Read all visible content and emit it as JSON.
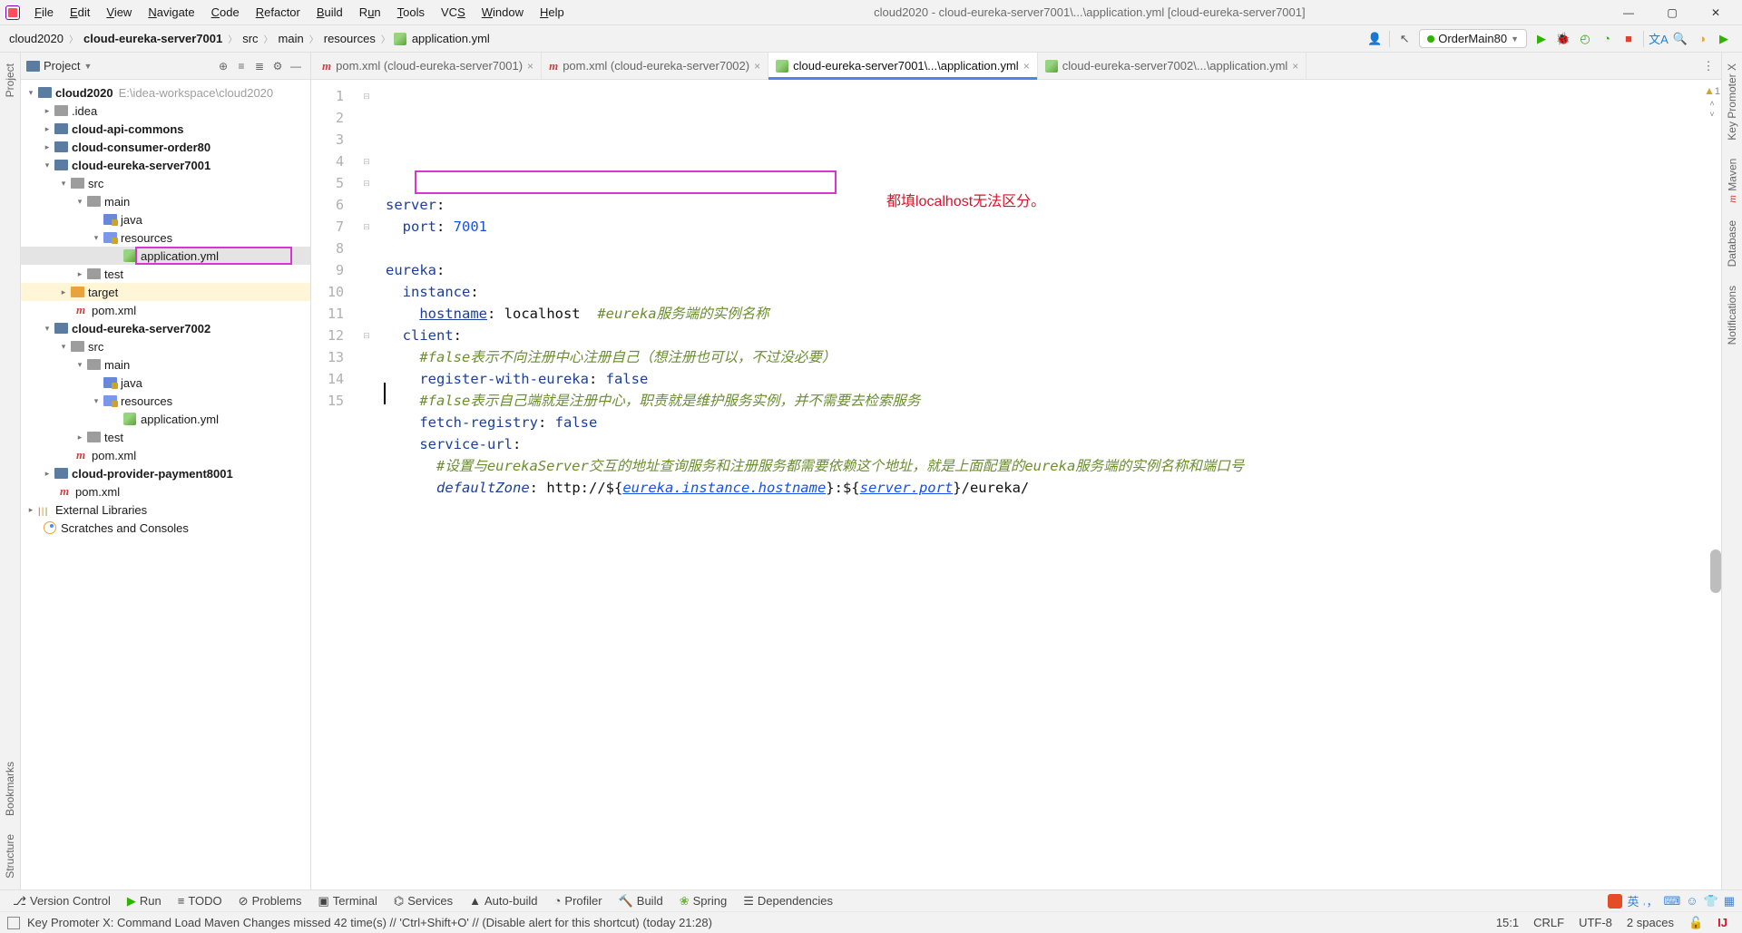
{
  "window": {
    "title": "cloud2020 - cloud-eureka-server7001\\...\\application.yml [cloud-eureka-server7001]"
  },
  "menu": {
    "items": [
      "File",
      "Edit",
      "View",
      "Navigate",
      "Code",
      "Refactor",
      "Build",
      "Run",
      "Tools",
      "VCS",
      "Window",
      "Help"
    ]
  },
  "breadcrumbs": {
    "items": [
      "cloud2020",
      "cloud-eureka-server7001",
      "src",
      "main",
      "resources",
      "application.yml"
    ]
  },
  "run_config": {
    "selected": "OrderMain80"
  },
  "project_panel": {
    "title": "Project",
    "tree": {
      "root": {
        "name": "cloud2020",
        "path": "E:\\idea-workspace\\cloud2020"
      },
      "idea": ".idea",
      "api_commons": "cloud-api-commons",
      "order80": "cloud-consumer-order80",
      "eureka7001": "cloud-eureka-server7001",
      "eureka7001_src": "src",
      "eureka7001_main": "main",
      "eureka7001_java": "java",
      "eureka7001_res": "resources",
      "eureka7001_app": "application.yml",
      "eureka7001_test": "test",
      "eureka7001_target": "target",
      "eureka7001_pom": "pom.xml",
      "eureka7002": "cloud-eureka-server7002",
      "eureka7002_src": "src",
      "eureka7002_main": "main",
      "eureka7002_java": "java",
      "eureka7002_res": "resources",
      "eureka7002_app": "application.yml",
      "eureka7002_test": "test",
      "eureka7002_pom": "pom.xml",
      "payment8001": "cloud-provider-payment8001",
      "root_pom": "pom.xml",
      "ext_lib": "External Libraries",
      "scratches": "Scratches and Consoles"
    }
  },
  "tabs": [
    {
      "label": "pom.xml (cloud-eureka-server7001)",
      "type": "mvn",
      "active": false
    },
    {
      "label": "pom.xml (cloud-eureka-server7002)",
      "type": "mvn",
      "active": false
    },
    {
      "label": "cloud-eureka-server7001\\...\\application.yml",
      "type": "yml",
      "active": true
    },
    {
      "label": "cloud-eureka-server7002\\...\\application.yml",
      "type": "yml",
      "active": false
    }
  ],
  "code": {
    "l1_a": "server",
    "l1_b": ":",
    "l2_a": "port",
    "l2_b": ": ",
    "l2_c": "7001",
    "l4_a": "eureka",
    "l4_b": ":",
    "l5_a": "instance",
    "l5_b": ":",
    "l6_a": "hostname",
    "l6_b": ": ",
    "l6_c": "localhost",
    "l6_d": "  #eureka服务端的实例名称",
    "l7_a": "client",
    "l7_b": ":",
    "l8": "#false表示不向注册中心注册自己（想注册也可以，不过没必要）",
    "l9_a": "register-with-eureka",
    "l9_b": ": ",
    "l9_c": "false",
    "l10": "#false表示自己端就是注册中心，职责就是维护服务实例，并不需要去检索服务",
    "l11_a": "fetch-registry",
    "l11_b": ": ",
    "l11_c": "false",
    "l12_a": "service-url",
    "l12_b": ":",
    "l13": "#设置与eurekaServer交互的地址查询服务和注册服务都需要依赖这个地址，就是上面配置的eureka服务端的实例名称和端口号",
    "l14_a": "defaultZone",
    "l14_b": ": ",
    "l14_c": "http://${",
    "l14_d": "eureka.instance.hostname",
    "l14_e": "}:${",
    "l14_f": "server.port",
    "l14_g": "}/eureka/",
    "annotation": "都填localhost无法区分。"
  },
  "line_numbers": [
    "1",
    "2",
    "3",
    "4",
    "5",
    "6",
    "7",
    "8",
    "9",
    "10",
    "11",
    "12",
    "13",
    "14",
    "15"
  ],
  "inspection": {
    "warn_count": "1"
  },
  "toolstrip": {
    "version_control": "Version Control",
    "run": "Run",
    "todo": "TODO",
    "problems": "Problems",
    "terminal": "Terminal",
    "services": "Services",
    "autobuild": "Auto-build",
    "profiler": "Profiler",
    "build": "Build",
    "spring": "Spring",
    "dependencies": "Dependencies"
  },
  "statusbar": {
    "msg": "Key Promoter X: Command Load Maven Changes missed 42 time(s) // 'Ctrl+Shift+O' // (Disable alert for this shortcut) (today 21:28)",
    "pos": "15:1",
    "eol": "CRLF",
    "enc": "UTF-8",
    "indent": "2 spaces"
  },
  "vbars": {
    "left_project": "Project",
    "left_bookmarks": "Bookmarks",
    "left_structure": "Structure",
    "right_keypromoter": "Key Promoter X",
    "right_maven": "Maven",
    "right_database": "Database",
    "right_notifications": "Notifications"
  }
}
